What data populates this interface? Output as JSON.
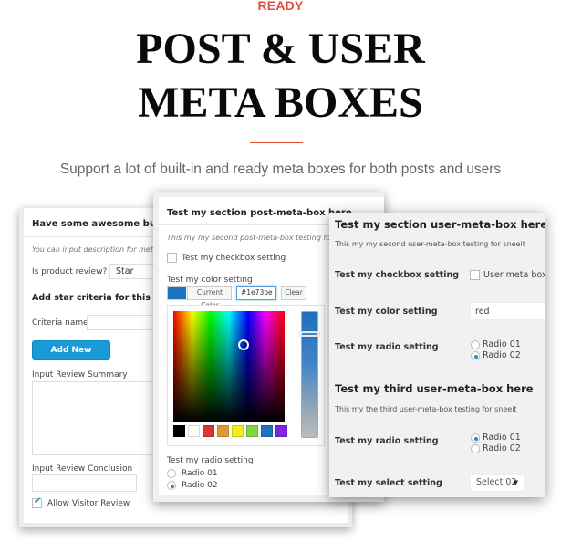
{
  "hero": {
    "eyebrow": "READY",
    "title_line1": "POST & USER",
    "title_line2": "META BOXES",
    "tagline": "Support a lot of built-in and ready meta boxes for both posts and users",
    "accent_color": "#e04e39"
  },
  "panel_review": {
    "title": "Have some awesome built-in",
    "description": "You can input description for meta",
    "review_label": "Is product review? :",
    "review_select": "Star",
    "criteria_heading": "Add star criteria for this produc",
    "criteria_label": "Criteria name:",
    "criteria_value": "",
    "add_button": "Add New Criteria",
    "summary_label": "Input Review Summary",
    "summary_value": "",
    "conclusion_label": "Input Review Conclusion",
    "conclusion_value": "",
    "allow_label": "Allow Visitor Review",
    "allow_checked": true,
    "button_color": "#1a9bd7"
  },
  "panel_post": {
    "title": "Test my section post-meta-box here",
    "description": "This my my second post-meta-box testing for s",
    "checkbox_label": "Test my checkbox setting",
    "checkbox_checked": false,
    "color_label": "Test my color setting",
    "current_color_label": "Current Color",
    "color_value": "#1e73be",
    "clear_label": "Clear",
    "palette": [
      "#000000",
      "#ffffff",
      "#dd3333",
      "#dd9933",
      "#eeee22",
      "#81d742",
      "#1e73be",
      "#8224e3"
    ],
    "radio_label": "Test my radio setting",
    "radio_options": [
      "Radio 01",
      "Radio 02"
    ],
    "radio_selected": "Radio 02"
  },
  "panel_user": {
    "section1": {
      "title": "Test my section user-meta-box here",
      "description": "This my my second user-meta-box testing for sneeit",
      "checkbox_label": "Test my checkbox setting",
      "checkbox_option": "User meta box",
      "checkbox_checked": false,
      "color_label": "Test my color setting",
      "color_value": "red",
      "radio_label": "Test my radio setting",
      "radio_options": [
        "Radio 01",
        "Radio 02"
      ],
      "radio_selected": "Radio 02"
    },
    "section2": {
      "title": "Test my third user-meta-box here",
      "description": "This my the third user-meta-box testing for sneeit",
      "radio_label": "Test my radio setting",
      "radio_options": [
        "Radio 01",
        "Radio 02"
      ],
      "radio_selected": "Radio 01",
      "select_label": "Test my select setting",
      "select_value": "Select 02"
    }
  }
}
